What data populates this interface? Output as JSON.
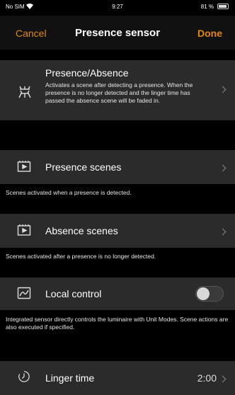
{
  "status_bar": {
    "carrier": "No SIM",
    "time": "9:27",
    "battery": "81 %"
  },
  "nav": {
    "cancel": "Cancel",
    "title": "Presence sensor",
    "done": "Done"
  },
  "presence_absence": {
    "title": "Presence/Absence",
    "description": "Activates a scene after detecting a presence. When the presence is no longer detected and the linger time has passed the absence scene will be faded in.",
    "icon": "presence-sensor-icon"
  },
  "presence_scenes": {
    "label": "Presence scenes",
    "footer": "Scenes activated when a presence is detected.",
    "icon": "scene-icon"
  },
  "absence_scenes": {
    "label": "Absence scenes",
    "footer": "Scenes activated after a presence is no longer detected.",
    "icon": "scene-icon"
  },
  "local_control": {
    "label": "Local control",
    "footer": "Integrated sensor directly controls the luminaire with Unit Modes. Scene actions are also executed if specified.",
    "enabled": false,
    "icon": "local-control-icon"
  },
  "linger_time": {
    "label": "Linger time",
    "value": "2:00",
    "icon": "timer-icon"
  }
}
